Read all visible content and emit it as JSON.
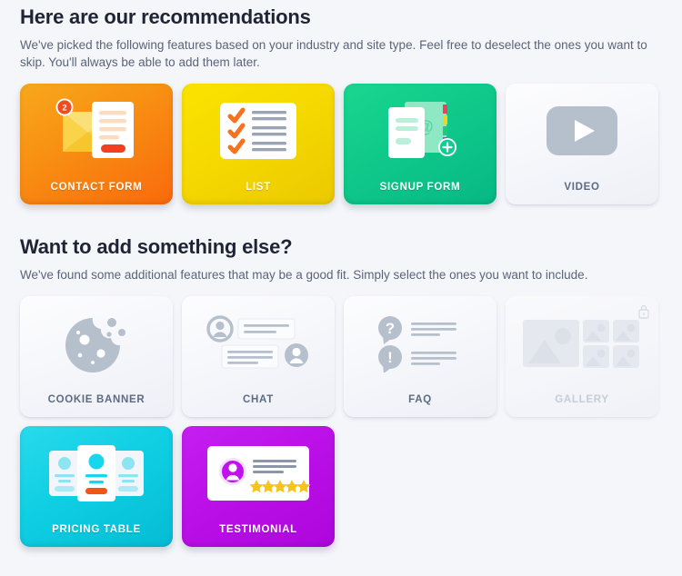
{
  "theme": {
    "page_background": "#f5f6fa",
    "heading_color": "#1e2433",
    "body_text_color": "#5a6478",
    "unselected_label_color": "#5d6b82",
    "locked_label_color": "#aab4c4"
  },
  "sections": [
    {
      "title": "Here are our recommendations",
      "description": "We've picked the following features based on your industry and site type. Feel free to deselect the ones you want to skip. You'll always be able to add them later.",
      "cards": [
        {
          "label": "CONTACT FORM",
          "icon": "contact-form-icon",
          "state": "selected",
          "color": "#f89213",
          "badge_count": "2"
        },
        {
          "label": "LIST",
          "icon": "checklist-icon",
          "state": "selected",
          "color": "#f5d900"
        },
        {
          "label": "SIGNUP FORM",
          "icon": "signup-form-icon",
          "state": "selected",
          "color": "#0fc98a"
        },
        {
          "label": "VIDEO",
          "icon": "video-play-icon",
          "state": "unselected",
          "color": "#b6c0cd"
        }
      ]
    },
    {
      "title": "Want to add something else?",
      "description": "We've found some additional features that may be a good fit. Simply select the ones you want to include.",
      "cards": [
        {
          "label": "COOKIE BANNER",
          "icon": "cookie-icon",
          "state": "unselected",
          "color": "#b6c0cd"
        },
        {
          "label": "CHAT",
          "icon": "chat-bubbles-icon",
          "state": "unselected",
          "color": "#b6c0cd"
        },
        {
          "label": "FAQ",
          "icon": "faq-icon",
          "state": "unselected",
          "color": "#b6c0cd"
        },
        {
          "label": "GALLERY",
          "icon": "gallery-icon",
          "state": "locked",
          "color": "#d7dce5",
          "lock_icon": "lock-icon"
        },
        {
          "label": "PRICING TABLE",
          "icon": "pricing-table-icon",
          "state": "selected",
          "color": "#0fcfe3"
        },
        {
          "label": "TESTIMONIAL",
          "icon": "testimonial-icon",
          "state": "selected",
          "color": "#bb10e8",
          "stars": 5
        }
      ]
    }
  ]
}
